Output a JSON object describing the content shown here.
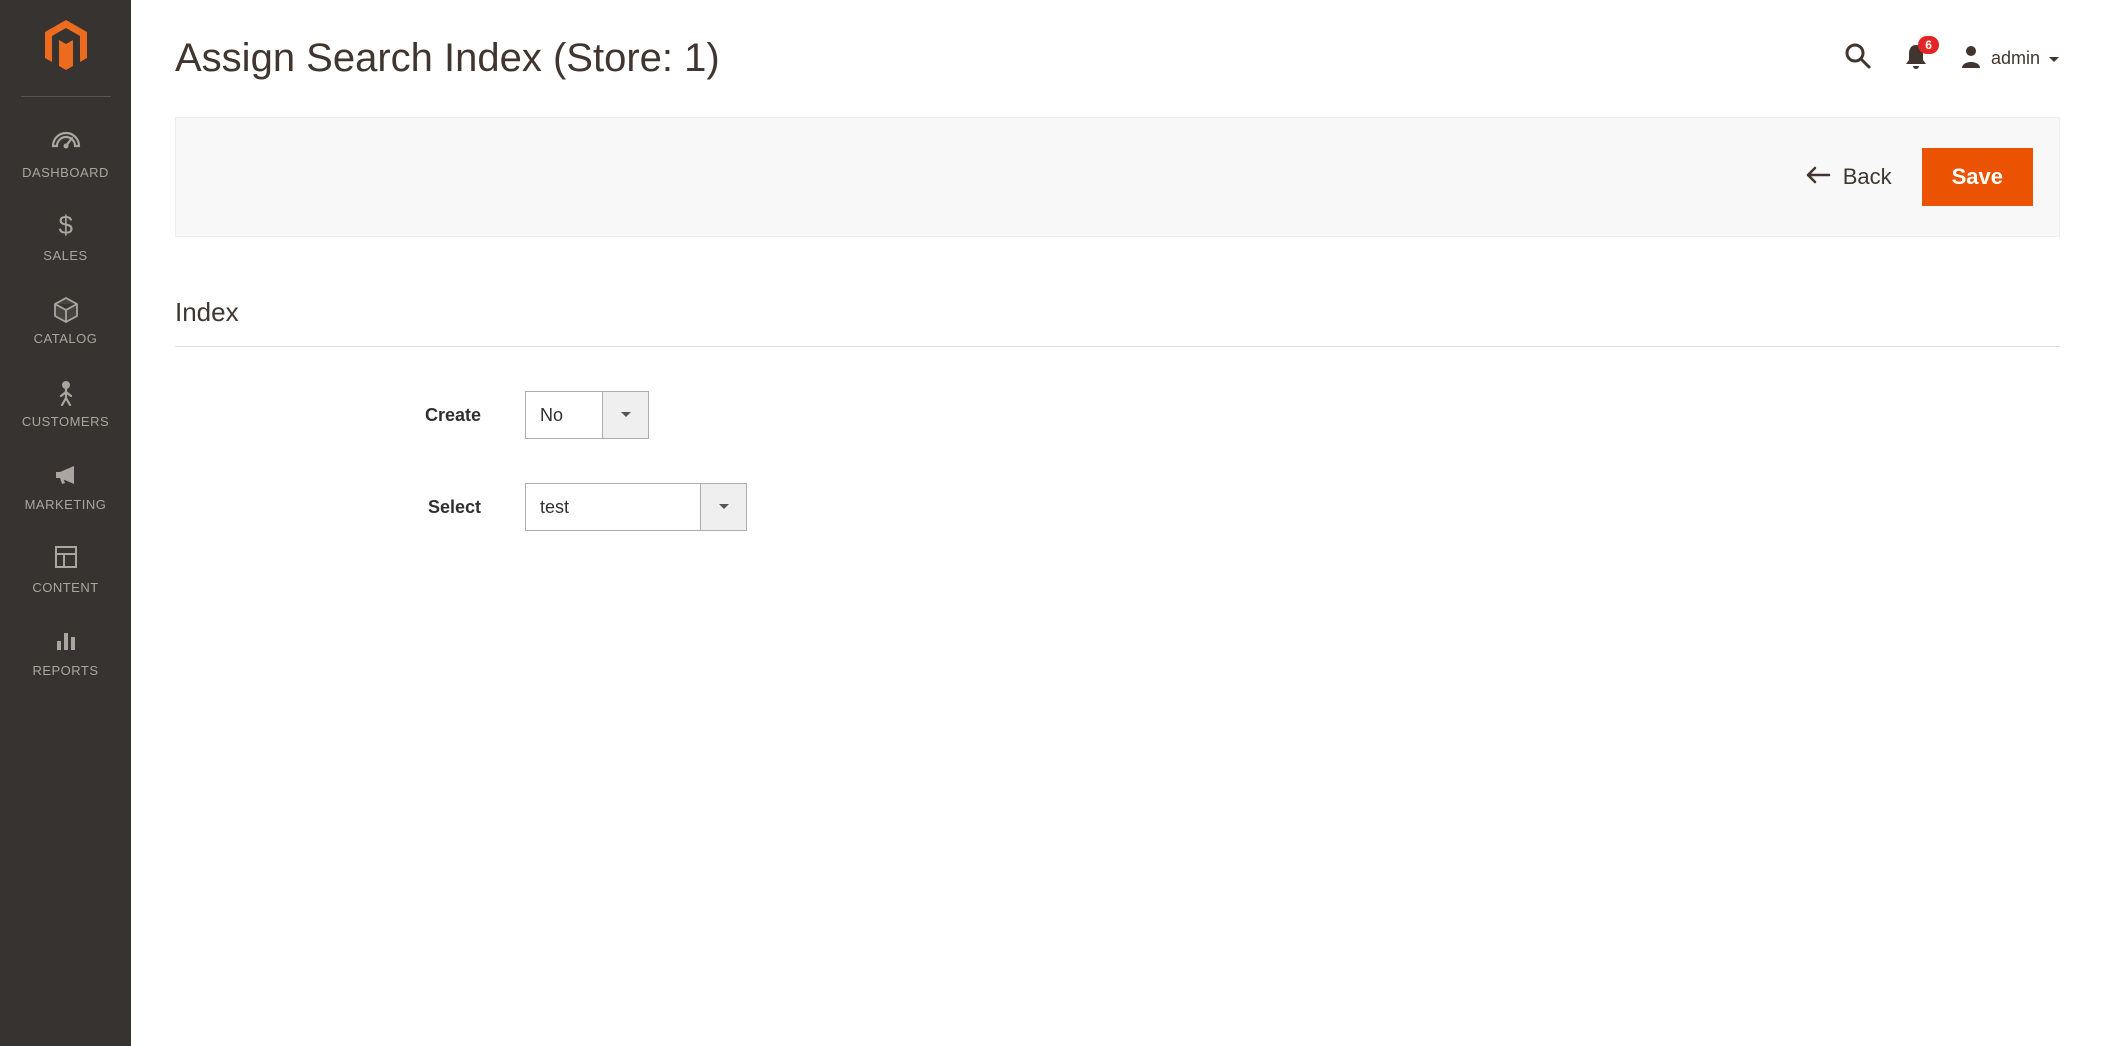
{
  "sidebar": {
    "items": [
      {
        "label": "DASHBOARD"
      },
      {
        "label": "SALES"
      },
      {
        "label": "CATALOG"
      },
      {
        "label": "CUSTOMERS"
      },
      {
        "label": "MARKETING"
      },
      {
        "label": "CONTENT"
      },
      {
        "label": "REPORTS"
      }
    ]
  },
  "header": {
    "title": "Assign Search Index (Store: 1)",
    "notification_count": "6",
    "admin_label": "admin"
  },
  "actions": {
    "back_label": "Back",
    "save_label": "Save"
  },
  "section": {
    "title": "Index"
  },
  "form": {
    "create": {
      "label": "Create",
      "value": "No"
    },
    "select": {
      "label": "Select",
      "value": "test"
    }
  }
}
